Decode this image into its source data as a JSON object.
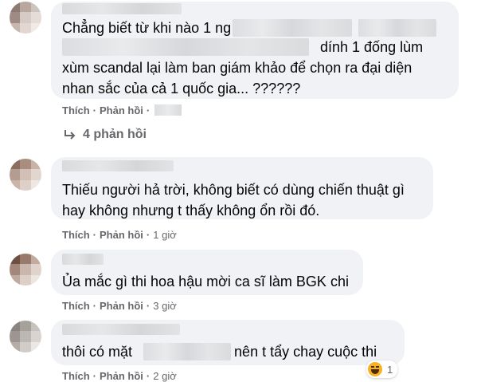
{
  "comments": [
    {
      "lines": [
        [
          "Chẳng biết từ khi nào 1 ng",
          "",
          ""
        ],
        [
          "",
          "dính 1 đống lùm"
        ],
        [
          "xùm scandal lại làm ban giám khảo để chọn ra đại diện"
        ],
        [
          "nhan sắc của cả 1 quốc gia... ??????"
        ]
      ],
      "actions": {
        "like": "Thích",
        "reply": "Phản hồi",
        "sep": "·"
      },
      "replies_label": "4 phản hồi"
    },
    {
      "lines": [
        "Thiếu người hả trời, không biết có dùng chiến thuật gì",
        "hay không nhưng t thấy không ổn rồi đó."
      ],
      "actions": {
        "like": "Thích",
        "reply": "Phản hồi",
        "sep": "·",
        "time": "1 giờ"
      }
    },
    {
      "lines": [
        "Ủa mắc gì thi hoa hậu mời ca sĩ làm BGK chi"
      ],
      "actions": {
        "like": "Thích",
        "reply": "Phản hồi",
        "sep": "·",
        "time": "3 giờ"
      }
    },
    {
      "lines": [
        "thôi có mặt",
        "nên t tẩy chay cuộc thi"
      ],
      "actions": {
        "like": "Thích",
        "reply": "Phản hồi",
        "sep": "·",
        "time": "2 giờ"
      },
      "reaction": {
        "icon": "laughing-emoji-icon",
        "count": "1"
      }
    }
  ],
  "colors": {
    "bubble": "#f0f2f5",
    "meta": "#65676b",
    "text": "#050505",
    "emoji": "#f7b125"
  }
}
